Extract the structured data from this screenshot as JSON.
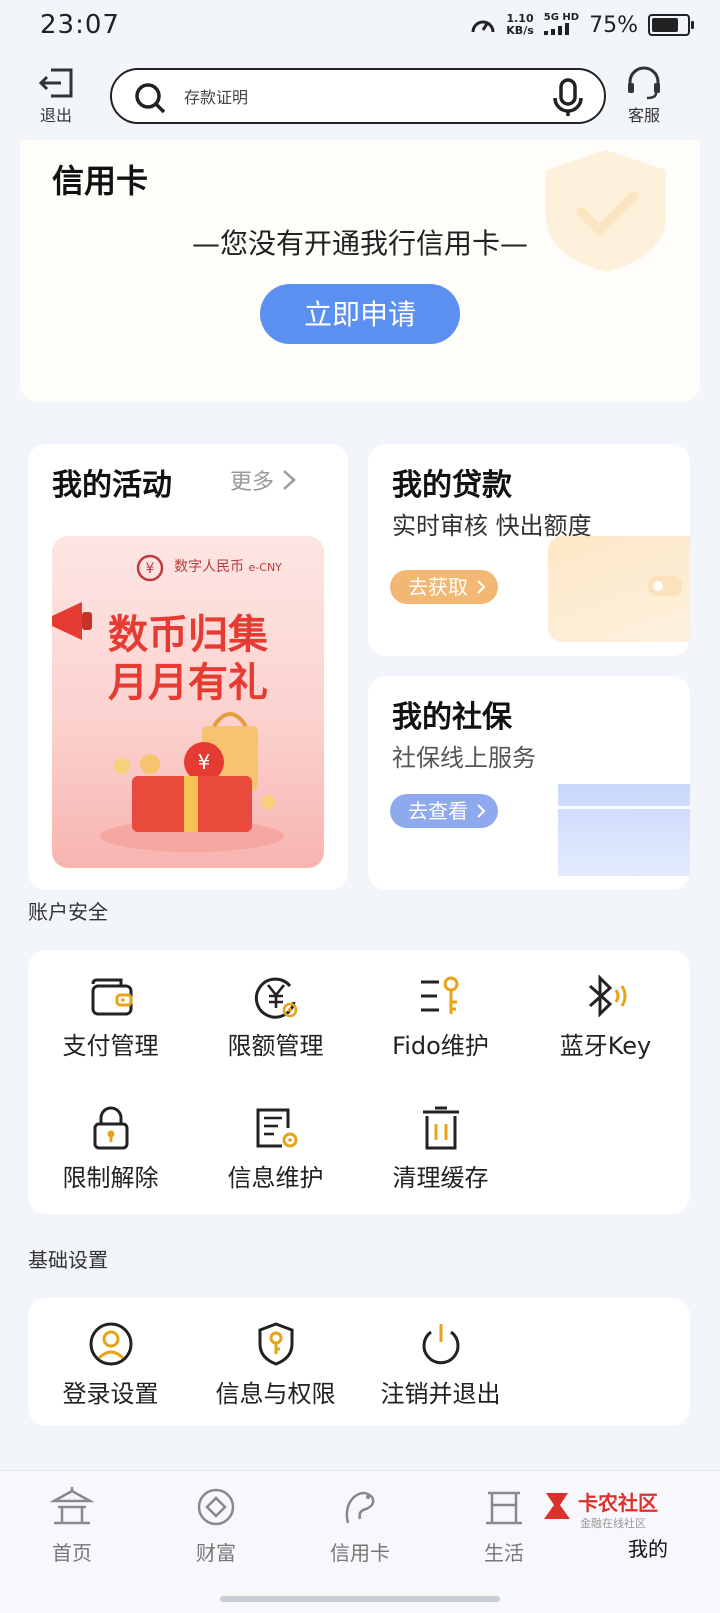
{
  "status": {
    "time": "23:07",
    "speed_value": "1.10",
    "speed_unit": "KB/s",
    "network": "5G HD",
    "battery_pct": "75%",
    "battery_level": 0.75
  },
  "top_bar": {
    "exit_label": "退出",
    "search_placeholder": "存款证明",
    "service_label": "客服"
  },
  "credit_card": {
    "title": "信用卡",
    "message": "—您没有开通我行信用卡—",
    "apply_label": "立即申请"
  },
  "activities": {
    "title": "我的活动",
    "more_label": "更多",
    "promo_brand": "数字人民币",
    "promo_brand_en": "e-CNY",
    "promo_line1": "数币归集",
    "promo_line2": "月月有礼"
  },
  "loan": {
    "title": "我的贷款",
    "subtitle": "实时审核 快出额度",
    "action": "去获取"
  },
  "social_security": {
    "title": "我的社保",
    "subtitle": "社保线上服务",
    "action": "去查看"
  },
  "account_security": {
    "label": "账户安全",
    "items": [
      {
        "label": "支付管理",
        "icon": "wallet-icon"
      },
      {
        "label": "限额管理",
        "icon": "yen-limit-icon"
      },
      {
        "label": "Fido维护",
        "icon": "fido-key-icon"
      },
      {
        "label": "蓝牙Key",
        "icon": "bluetooth-icon"
      },
      {
        "label": "限制解除",
        "icon": "lock-icon"
      },
      {
        "label": "信息维护",
        "icon": "document-gear-icon"
      },
      {
        "label": "清理缓存",
        "icon": "trash-icon"
      }
    ]
  },
  "basic_settings": {
    "label": "基础设置",
    "items": [
      {
        "label": "登录设置",
        "icon": "user-circle-icon"
      },
      {
        "label": "信息与权限",
        "icon": "shield-key-icon"
      },
      {
        "label": "注销并退出",
        "icon": "power-icon"
      }
    ]
  },
  "bottom_nav": {
    "items": [
      {
        "label": "首页",
        "icon": "home-pavilion-icon"
      },
      {
        "label": "财富",
        "icon": "wealth-diamond-icon"
      },
      {
        "label": "信用卡",
        "icon": "credit-card-icon"
      },
      {
        "label": "生活",
        "icon": "life-icon"
      },
      {
        "label": "我的",
        "icon": "profile-icon"
      }
    ],
    "active": "我的",
    "watermark_cn": "卡农社区",
    "watermark_sub": "金融在线社区"
  },
  "colors": {
    "accent": "#e8a317",
    "apply_button": "#5b8ff0",
    "pill_orange": "#f3b774",
    "pill_blue": "#8fa9ef",
    "promo_red": "#e53b32"
  }
}
